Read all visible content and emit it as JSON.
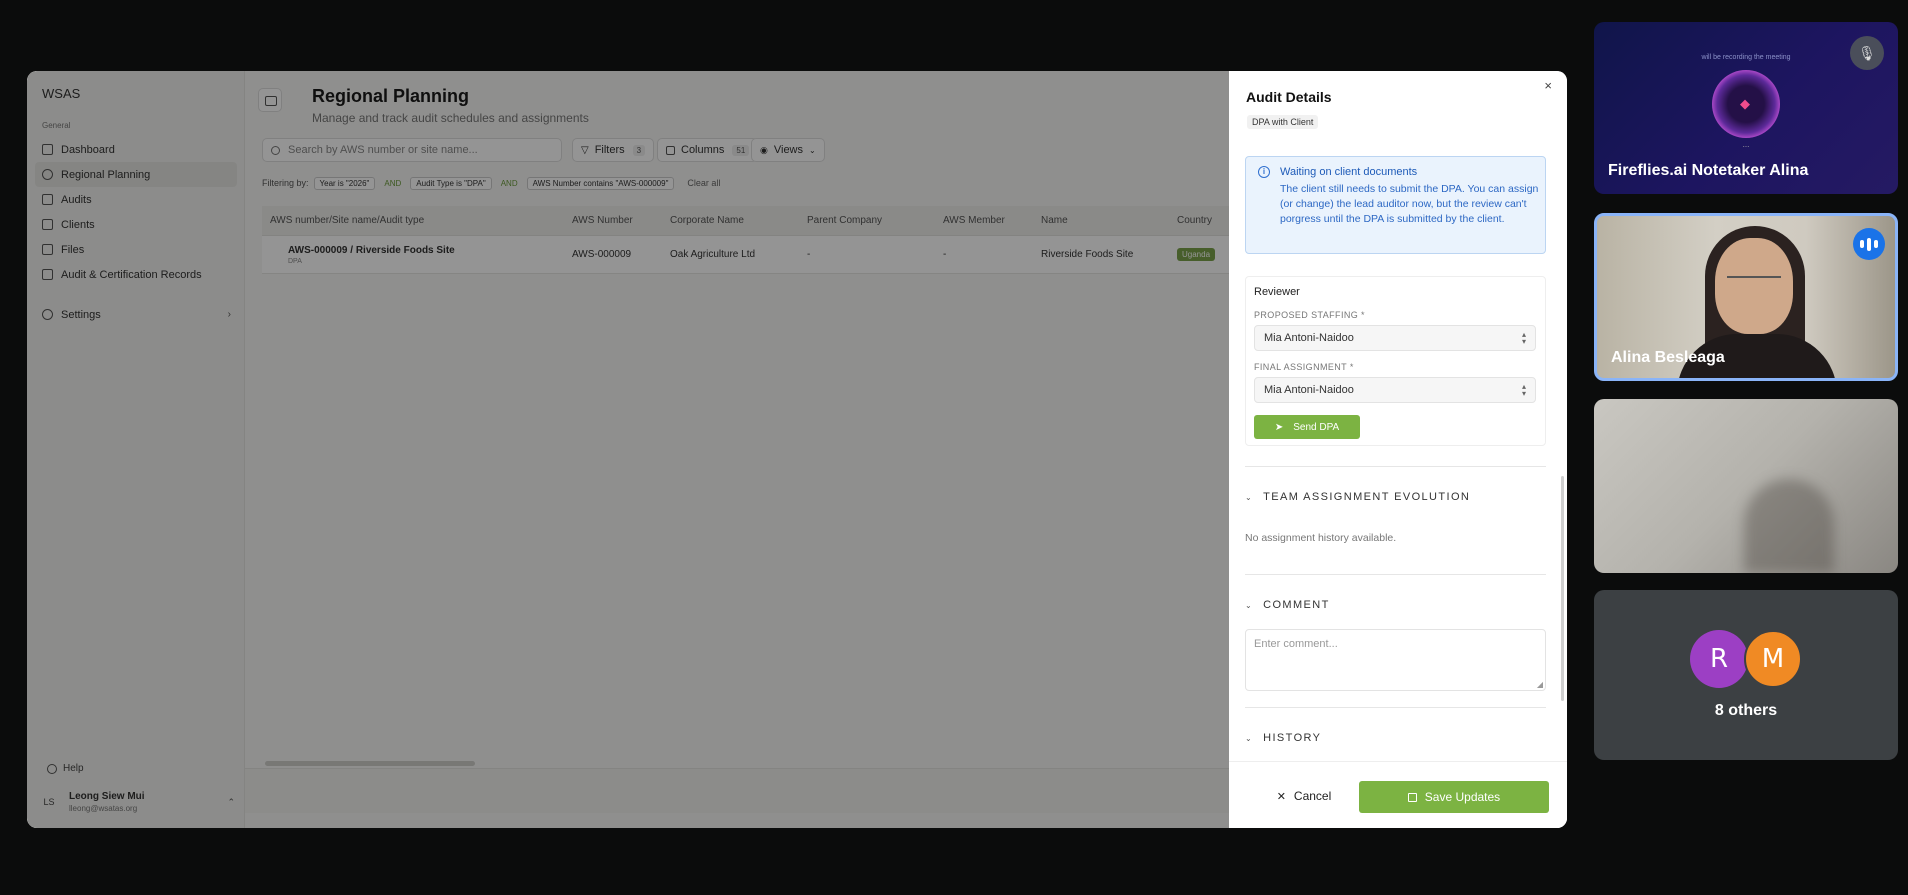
{
  "app": {
    "brand": "WSAS",
    "nav_section": "General",
    "nav": [
      {
        "label": "Dashboard"
      },
      {
        "label": "Regional Planning"
      },
      {
        "label": "Audits"
      },
      {
        "label": "Clients"
      },
      {
        "label": "Files"
      },
      {
        "label": "Audit & Certification Records"
      }
    ],
    "settings_label": "Settings",
    "help_label": "Help",
    "user": {
      "initials": "LS",
      "name": "Leong Siew Mui",
      "email": "lleong@wsatas.org"
    }
  },
  "page": {
    "title": "Regional Planning",
    "subtitle": "Manage and track audit schedules and assignments",
    "search_placeholder": "Search by AWS number or site name...",
    "filters_label": "Filters",
    "filters_count": "3",
    "columns_label": "Columns",
    "columns_count": "51",
    "views_label": "Views",
    "filtering_by": "Filtering by:",
    "filter_chips": [
      "Year is \"2026\"",
      "Audit Type is \"DPA\"",
      "AWS Number contains \"AWS-000009\""
    ],
    "and_label": "AND",
    "clear_all": "Clear all"
  },
  "table": {
    "columns": [
      "AWS number/Site name/Audit type",
      "AWS Number",
      "Corporate Name",
      "Parent Company",
      "AWS Member",
      "Name",
      "Country"
    ],
    "rows": [
      {
        "site": "AWS-000009 / Riverside Foods Site",
        "audit_type": "DPA",
        "aws_number": "AWS-000009",
        "corporate": "Oak Agriculture Ltd",
        "parent": "-",
        "member": "-",
        "name": "Riverside Foods Site",
        "country": "Uganda"
      }
    ]
  },
  "drawer": {
    "close": "×",
    "title": "Audit Details",
    "tag": "DPA with Client",
    "info_title": "Waiting on client documents",
    "info_text": "The client still needs to submit the DPA. You can assign (or change) the lead auditor now, but the review can't porgress until the DPA is submitted by the client.",
    "reviewer_title": "Reviewer",
    "proposed_label": "PROPOSED STAFFING *",
    "proposed_value": "Mia Antoni-Naidoo",
    "final_label": "FINAL ASSIGNMENT *",
    "final_value": "Mia Antoni-Naidoo",
    "send_label": "Send DPA",
    "team_section": "TEAM ASSIGNMENT EVOLUTION",
    "no_history": "No assignment history available.",
    "comment_section": "COMMENT",
    "comment_placeholder": "Enter comment...",
    "history_section": "HISTORY",
    "cancel_label": "Cancel",
    "save_label": "Save Updates"
  },
  "meeting": {
    "notetaker_text": "will be recording the meeting",
    "notetaker_dots": "...",
    "tile1_name": "Fireflies.ai Notetaker Alina",
    "tile2_name": "Alina Besleaga",
    "avatar_r": "R",
    "avatar_m": "M",
    "others_label": "8 others"
  },
  "colors": {
    "accent_green": "#7cb342",
    "info_blue": "#2d68c4",
    "active_tile_border": "#8ab4f8",
    "avatar_r": "#9c3fc4",
    "avatar_m": "#f08a24"
  },
  "icons": [
    "mic-off-icon",
    "speaking-icon",
    "info-icon",
    "send-icon",
    "save-icon",
    "close-icon",
    "search-icon",
    "filter-icon",
    "columns-icon",
    "eye-icon",
    "chevron-down-icon"
  ]
}
